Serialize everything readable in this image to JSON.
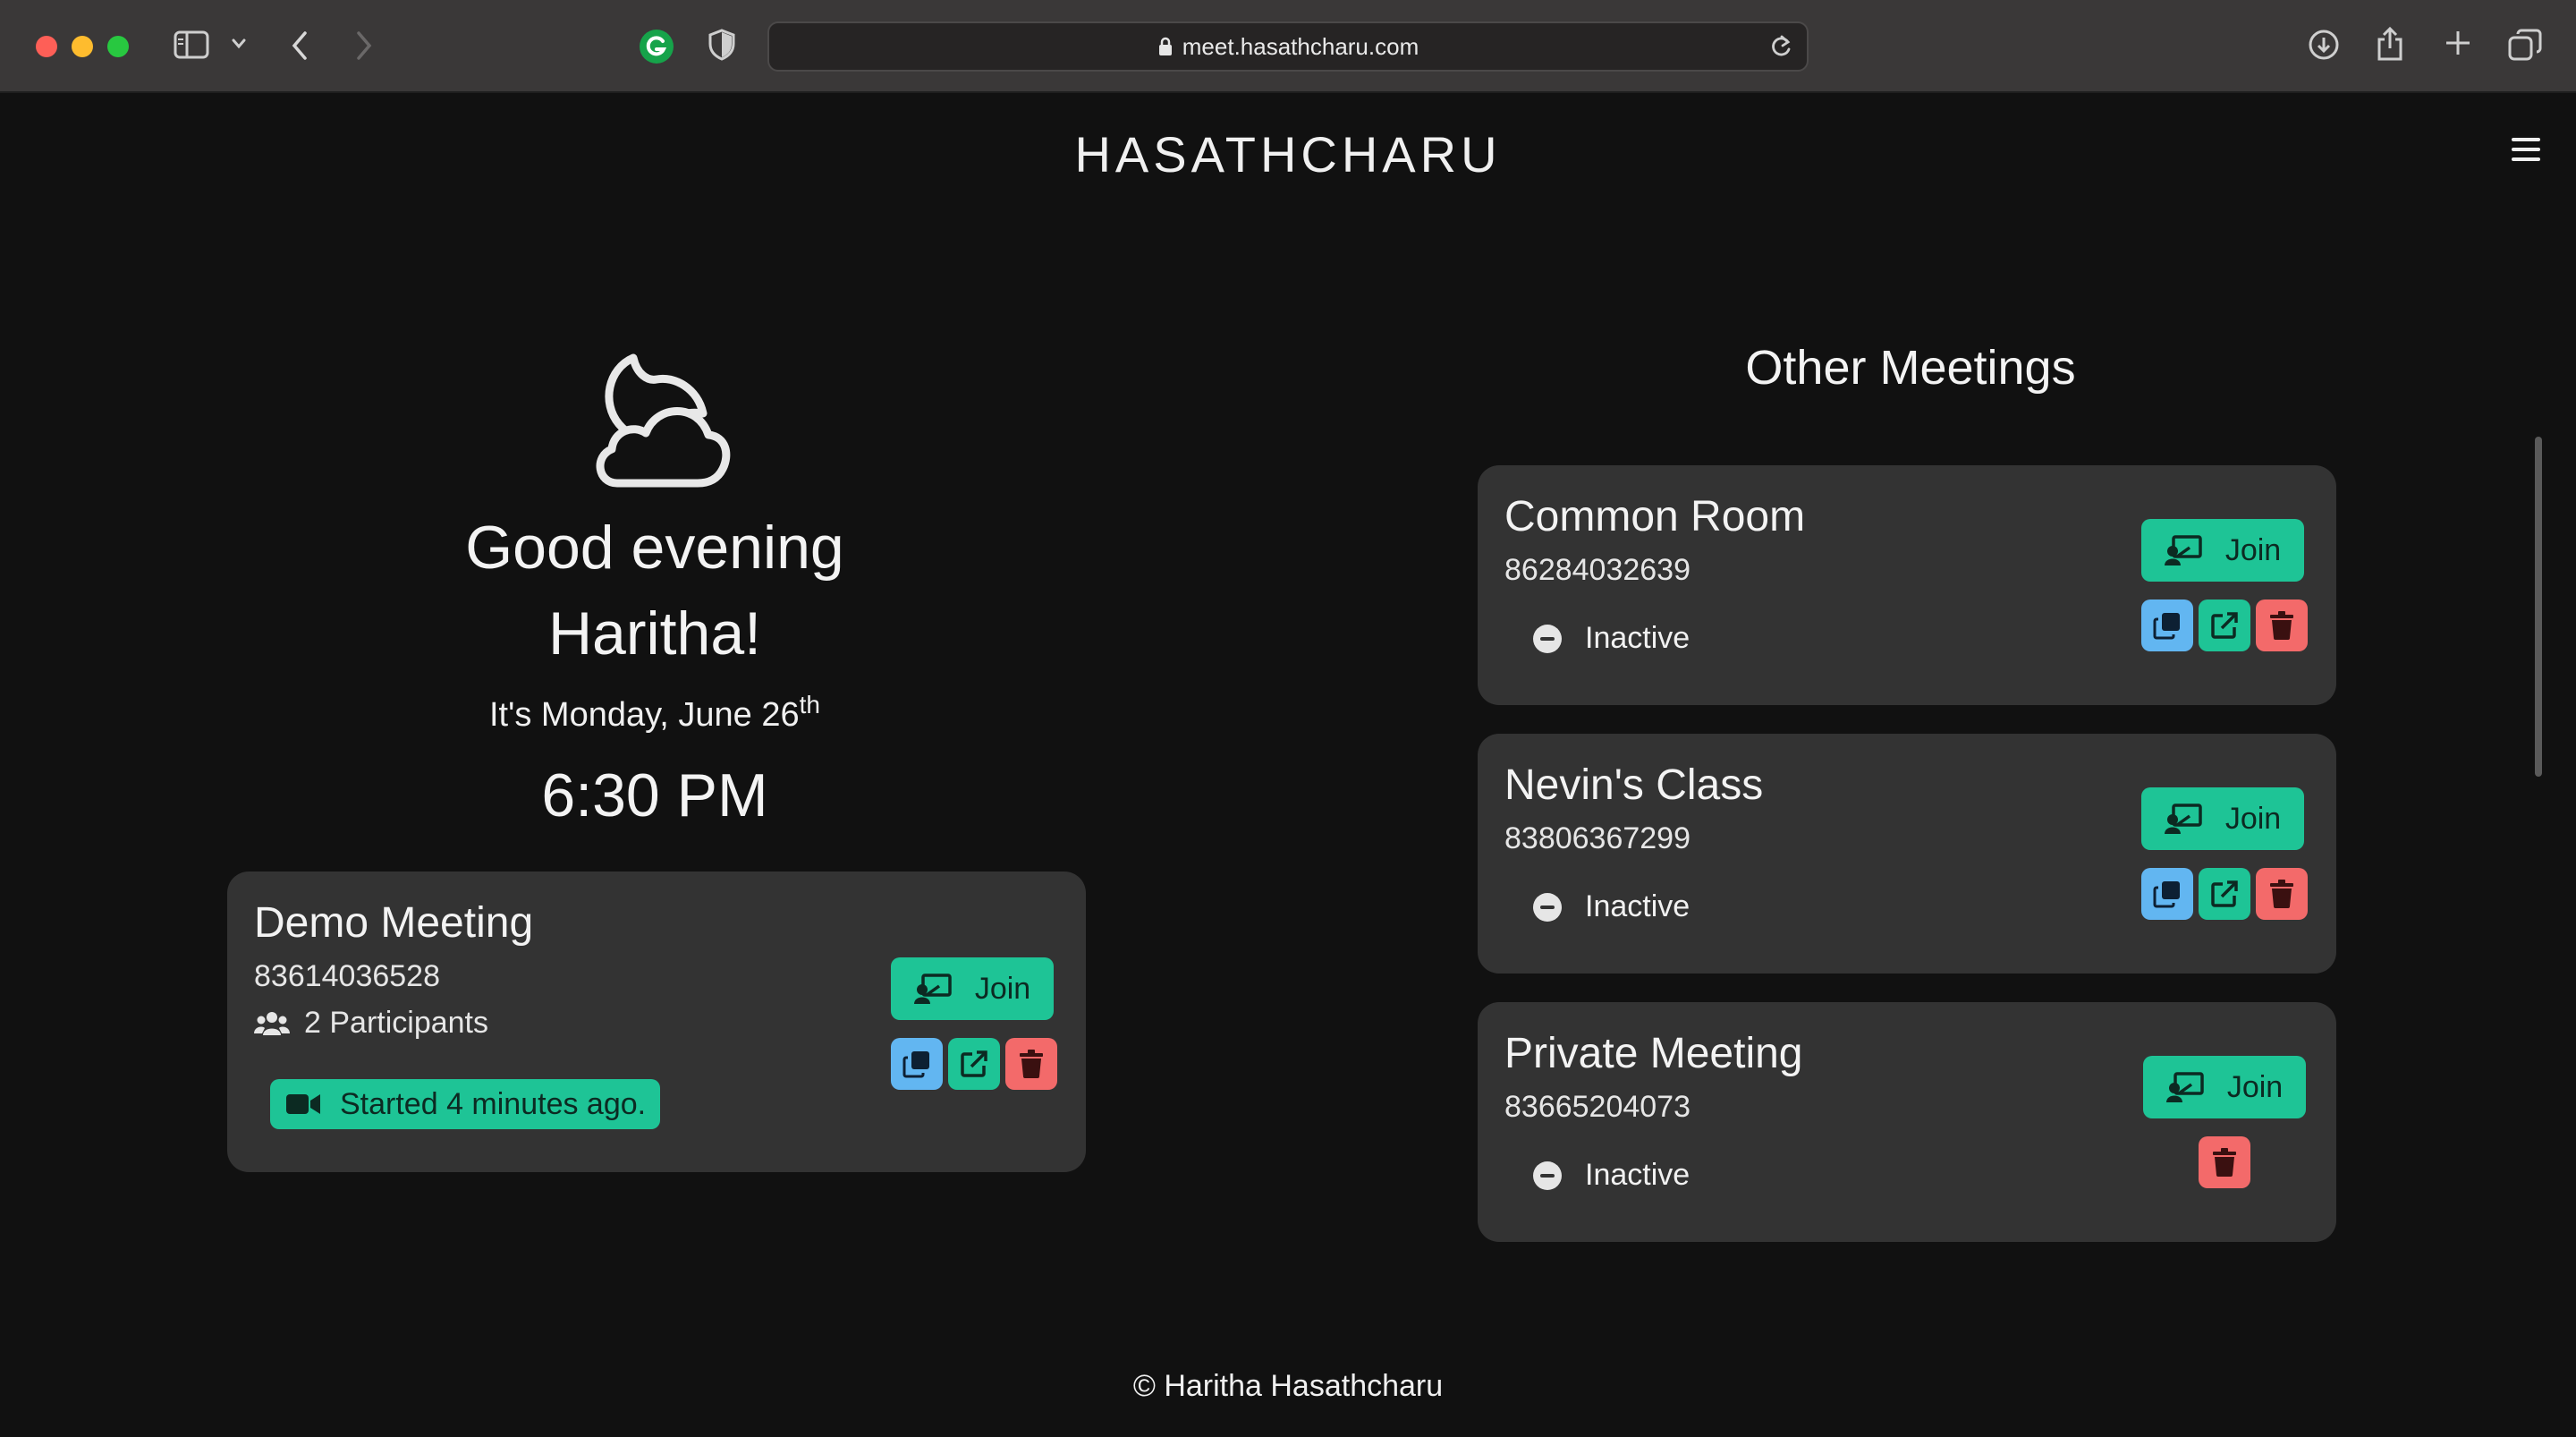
{
  "browser": {
    "url": "meet.hasathcharu.com"
  },
  "brand": "HASATHCHARU",
  "greeting": {
    "line1": "Good evening",
    "line2": "Haritha!",
    "date_prefix": "It's Monday, June 26",
    "date_suffix": "th",
    "time": "6:30 PM"
  },
  "current_meeting": {
    "title": "Demo Meeting",
    "id": "83614036528",
    "participants": "2 Participants",
    "status": "Started 4 minutes ago.",
    "join_label": "Join"
  },
  "other_meetings": {
    "heading": "Other Meetings",
    "items": [
      {
        "title": "Common Room",
        "id": "86284032639",
        "status": "Inactive",
        "join_label": "Join"
      },
      {
        "title": "Nevin's Class",
        "id": "83806367299",
        "status": "Inactive",
        "join_label": "Join"
      },
      {
        "title": "Private Meeting",
        "id": "83665204073",
        "status": "Inactive",
        "join_label": "Join"
      }
    ]
  },
  "footer": "© Haritha Hasathcharu",
  "colors": {
    "accent": "#1ec496",
    "copy": "#62b6f1",
    "delete": "#f36a6a",
    "card": "#333333",
    "background": "#111111"
  }
}
